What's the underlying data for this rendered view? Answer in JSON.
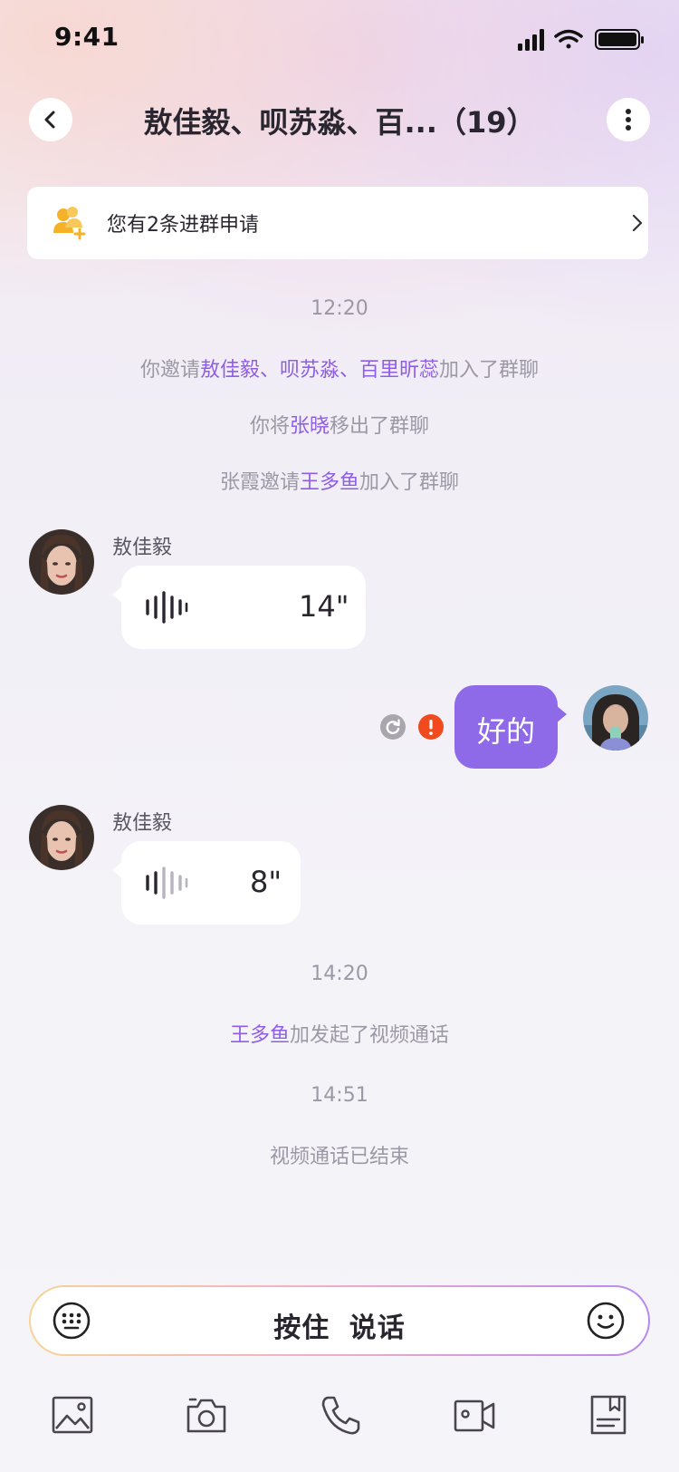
{
  "status_bar": {
    "time": "9:41"
  },
  "header": {
    "title": "敖佳毅、呗苏淼、百...（19）"
  },
  "banner": {
    "text": "您有2条进群申请"
  },
  "events": [
    {
      "time": "12:20"
    },
    {
      "prefix": "你邀请",
      "highlight": "敖佳毅、呗苏淼、百里昕蕊",
      "suffix": "加入了群聊"
    },
    {
      "prefix": "你将",
      "highlight": "张晓",
      "suffix": "移出了群聊"
    },
    {
      "prefix": "张霞邀请",
      "highlight": "王多鱼",
      "suffix": "加入了群聊"
    }
  ],
  "messages": [
    {
      "sender": "敖佳毅",
      "duration": "14\""
    },
    {
      "text": "好的"
    },
    {
      "sender": "敖佳毅",
      "duration": "8\""
    }
  ],
  "events_2": [
    {
      "time": "14:20"
    },
    {
      "highlight": "王多鱼",
      "suffix": "加发起了视频通话"
    },
    {
      "time": "14:51"
    },
    {
      "text": "视频通话已结束"
    }
  ],
  "input": {
    "hold_to_talk": "按住 说话"
  },
  "colors": {
    "accent": "#8E5EE6",
    "bubble_out": "#8E6AE8",
    "error": "#F04A1E",
    "banner_icon": "#F5B227"
  }
}
